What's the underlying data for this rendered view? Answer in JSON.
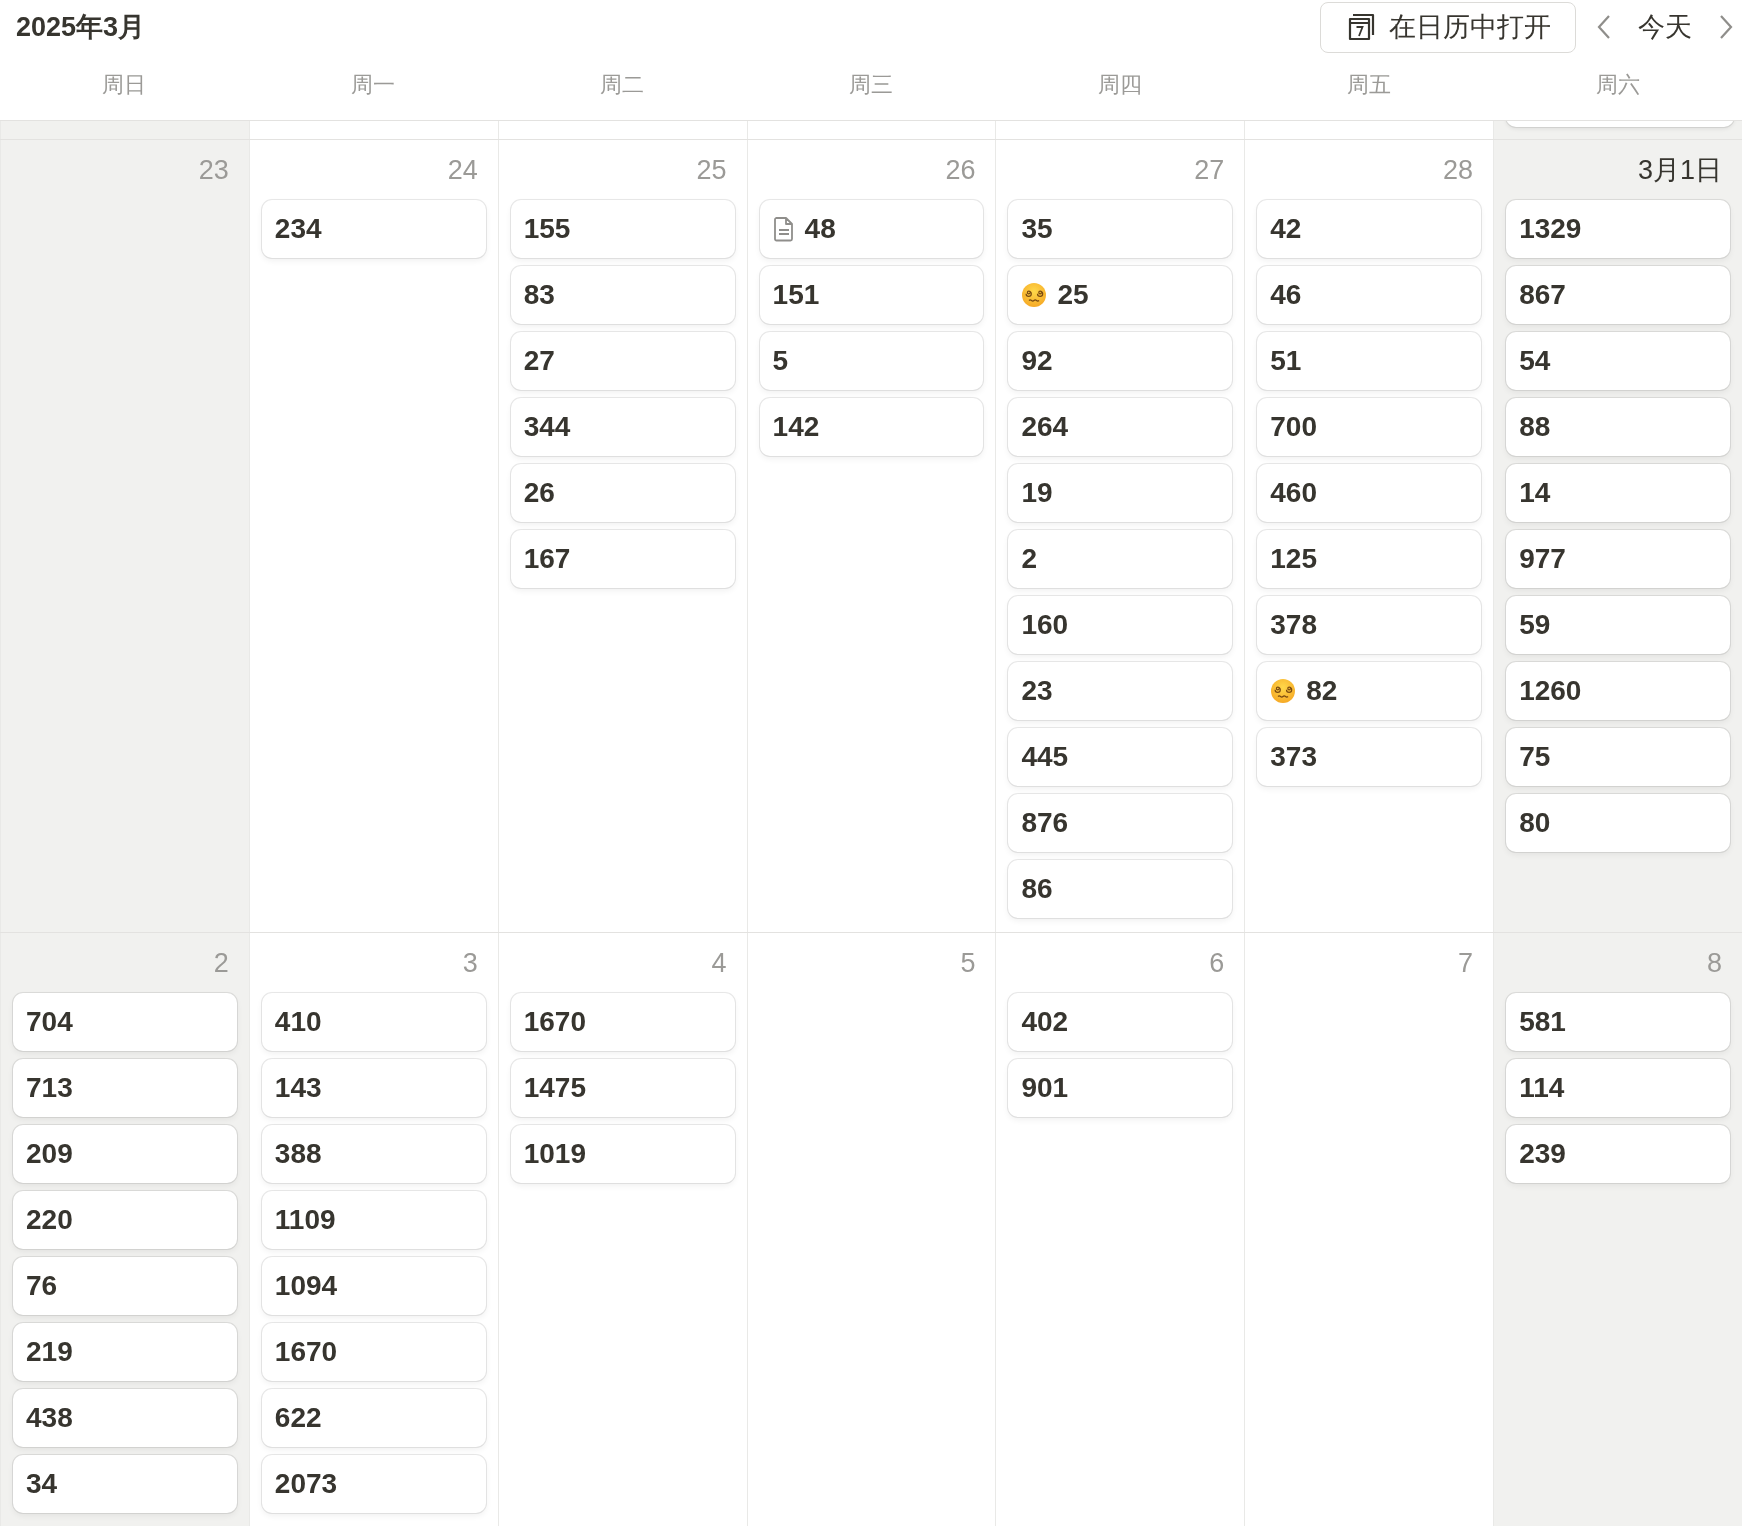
{
  "header": {
    "title": "2025年3月",
    "open_button": "在日历中打开",
    "today_button": "今天"
  },
  "weekdays": [
    {
      "label": "周日"
    },
    {
      "label": "周一"
    },
    {
      "label": "周二"
    },
    {
      "label": "周三"
    },
    {
      "label": "周四"
    },
    {
      "label": "周五"
    },
    {
      "label": "周六"
    }
  ],
  "partial_week": {
    "days": [
      {
        "weekend": true,
        "card_peek": false
      },
      {
        "weekend": false,
        "card_peek": false
      },
      {
        "weekend": false,
        "card_peek": false
      },
      {
        "weekend": false,
        "card_peek": false
      },
      {
        "weekend": false,
        "card_peek": false
      },
      {
        "weekend": false,
        "card_peek": false
      },
      {
        "weekend": true,
        "card_peek": true
      }
    ]
  },
  "weeks": [
    {
      "days": [
        {
          "label": "23",
          "weekend": true,
          "month_start": false
        },
        {
          "label": "24",
          "weekend": false,
          "month_start": false,
          "events": [
            {
              "kind": "plain",
              "title": "234"
            }
          ]
        },
        {
          "label": "25",
          "weekend": false,
          "month_start": false,
          "events": [
            {
              "kind": "plain",
              "title": "155"
            },
            {
              "kind": "plain",
              "title": "83"
            },
            {
              "kind": "plain",
              "title": "27"
            },
            {
              "kind": "plain",
              "title": "344"
            },
            {
              "kind": "plain",
              "title": "26"
            },
            {
              "kind": "plain",
              "title": "167"
            }
          ]
        },
        {
          "label": "26",
          "weekend": false,
          "month_start": false,
          "events": [
            {
              "kind": "page",
              "title": "48"
            },
            {
              "kind": "plain",
              "title": "151"
            },
            {
              "kind": "plain",
              "title": "5"
            },
            {
              "kind": "plain",
              "title": "142"
            }
          ]
        },
        {
          "label": "27",
          "weekend": false,
          "month_start": false,
          "events": [
            {
              "kind": "plain",
              "title": "35"
            },
            {
              "kind": "emoji",
              "title": "25"
            },
            {
              "kind": "plain",
              "title": "92"
            },
            {
              "kind": "plain",
              "title": "264"
            },
            {
              "kind": "plain",
              "title": "19"
            },
            {
              "kind": "plain",
              "title": "2"
            },
            {
              "kind": "plain",
              "title": "160"
            },
            {
              "kind": "plain",
              "title": "23"
            },
            {
              "kind": "plain",
              "title": "445"
            },
            {
              "kind": "plain",
              "title": "876"
            },
            {
              "kind": "plain",
              "title": "86"
            }
          ]
        },
        {
          "label": "28",
          "weekend": false,
          "month_start": false,
          "events": [
            {
              "kind": "plain",
              "title": "42"
            },
            {
              "kind": "plain",
              "title": "46"
            },
            {
              "kind": "plain",
              "title": "51"
            },
            {
              "kind": "plain",
              "title": "700"
            },
            {
              "kind": "plain",
              "title": "460"
            },
            {
              "kind": "plain",
              "title": "125"
            },
            {
              "kind": "plain",
              "title": "378"
            },
            {
              "kind": "emoji",
              "title": "82"
            },
            {
              "kind": "plain",
              "title": "373"
            }
          ]
        },
        {
          "label": "3月1日",
          "weekend": true,
          "month_start": true,
          "events": [
            {
              "kind": "plain",
              "title": "1329"
            },
            {
              "kind": "plain",
              "title": "867"
            },
            {
              "kind": "plain",
              "title": "54"
            },
            {
              "kind": "plain",
              "title": "88"
            },
            {
              "kind": "plain",
              "title": "14"
            },
            {
              "kind": "plain",
              "title": "977"
            },
            {
              "kind": "plain",
              "title": "59"
            },
            {
              "kind": "plain",
              "title": "1260"
            },
            {
              "kind": "plain",
              "title": "75"
            },
            {
              "kind": "plain",
              "title": "80"
            }
          ]
        }
      ]
    },
    {
      "days": [
        {
          "label": "2",
          "weekend": true,
          "month_start": false,
          "events": [
            {
              "kind": "plain",
              "title": "704"
            },
            {
              "kind": "plain",
              "title": "713"
            },
            {
              "kind": "plain",
              "title": "209"
            },
            {
              "kind": "plain",
              "title": "220"
            },
            {
              "kind": "plain",
              "title": "76"
            },
            {
              "kind": "plain",
              "title": "219"
            },
            {
              "kind": "plain",
              "title": "438"
            },
            {
              "kind": "plain",
              "title": "34"
            }
          ]
        },
        {
          "label": "3",
          "weekend": false,
          "month_start": false,
          "events": [
            {
              "kind": "plain",
              "title": "410"
            },
            {
              "kind": "plain",
              "title": "143"
            },
            {
              "kind": "plain",
              "title": "388"
            },
            {
              "kind": "plain",
              "title": "1109"
            },
            {
              "kind": "plain",
              "title": "1094"
            },
            {
              "kind": "plain",
              "title": "1670"
            },
            {
              "kind": "plain",
              "title": "622"
            },
            {
              "kind": "plain",
              "title": "2073"
            }
          ]
        },
        {
          "label": "4",
          "weekend": false,
          "month_start": false,
          "events": [
            {
              "kind": "plain",
              "title": "1670"
            },
            {
              "kind": "plain",
              "title": "1475"
            },
            {
              "kind": "plain",
              "title": "1019"
            }
          ]
        },
        {
          "label": "5",
          "weekend": false,
          "month_start": false
        },
        {
          "label": "6",
          "weekend": false,
          "month_start": false,
          "events": [
            {
              "kind": "plain",
              "title": "402"
            },
            {
              "kind": "plain",
              "title": "901"
            }
          ]
        },
        {
          "label": "7",
          "weekend": false,
          "month_start": false
        },
        {
          "label": "8",
          "weekend": true,
          "month_start": false,
          "events": [
            {
              "kind": "plain",
              "title": "581"
            },
            {
              "kind": "plain",
              "title": "114"
            },
            {
              "kind": "plain",
              "title": "239"
            }
          ]
        }
      ]
    }
  ]
}
